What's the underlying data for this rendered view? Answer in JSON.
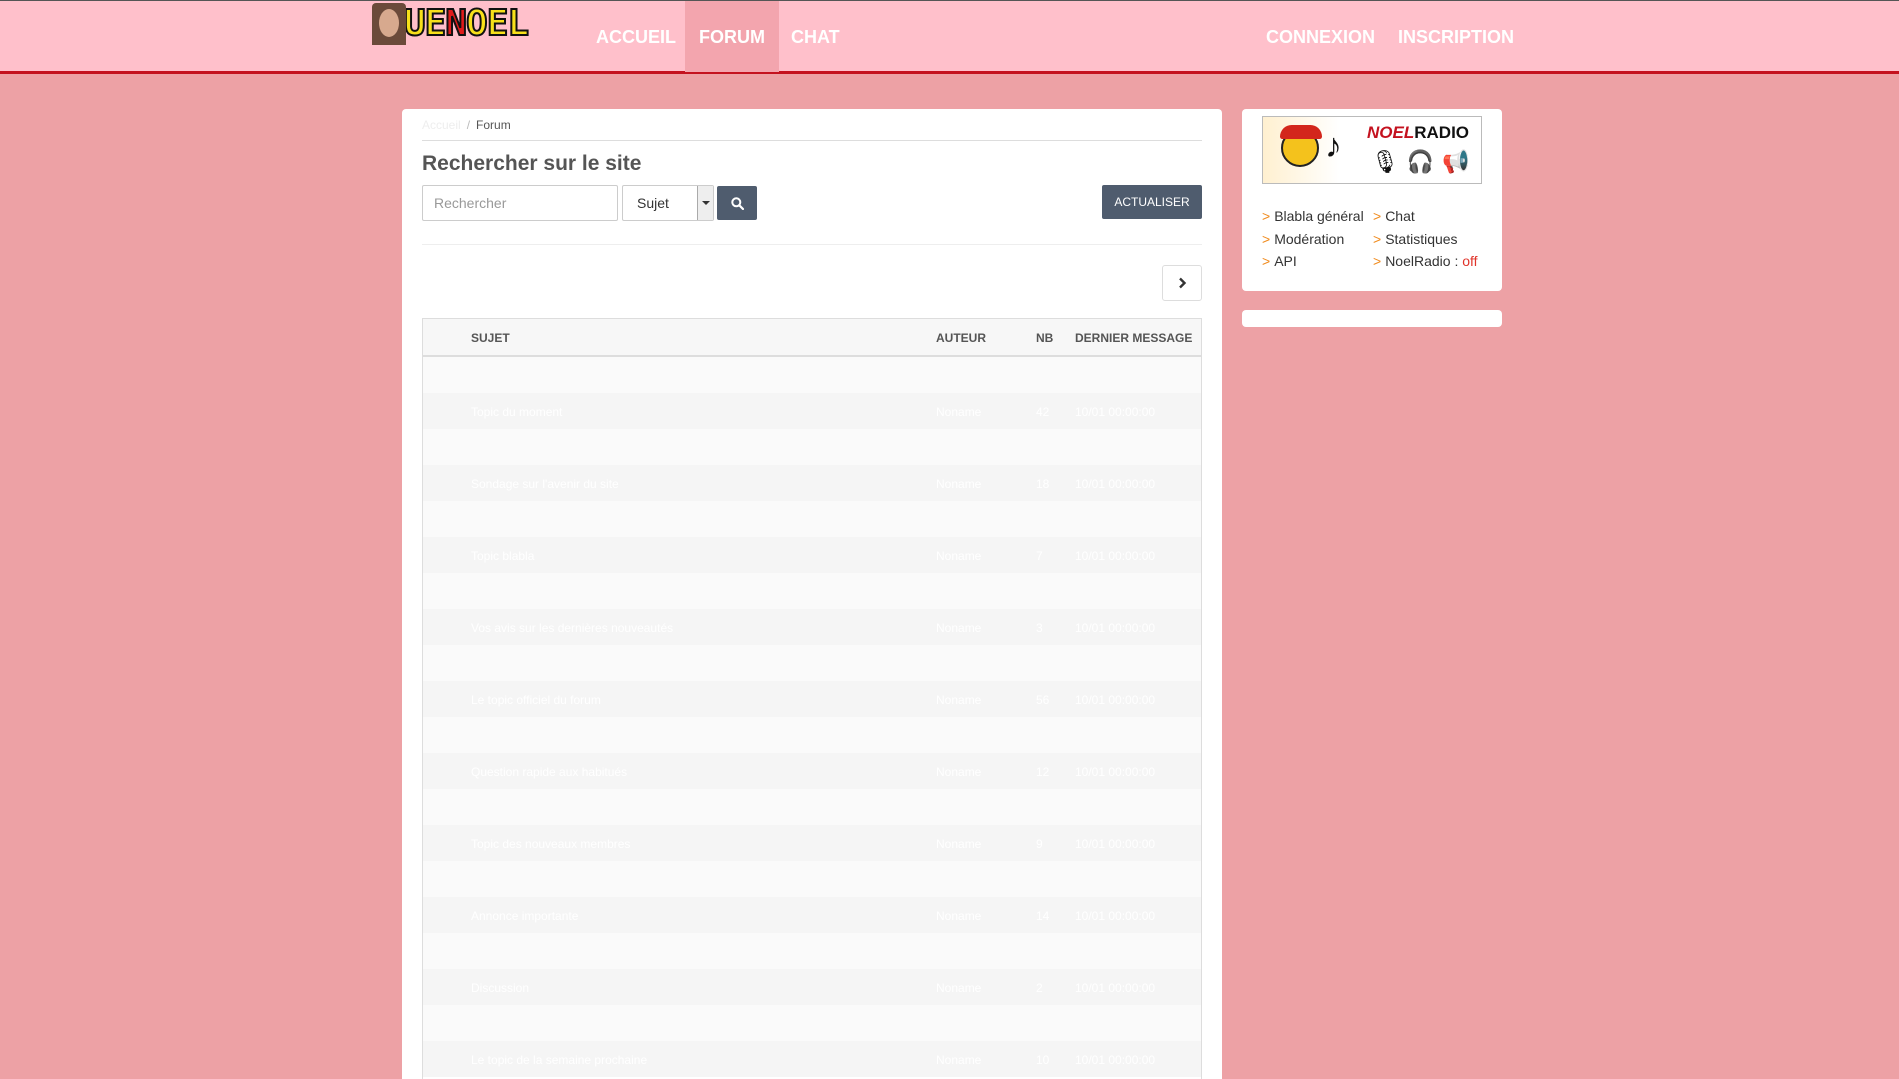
{
  "brand": {
    "logo_text_a": "UE",
    "logo_text_b": "N",
    "logo_text_c": "OEL"
  },
  "nav": {
    "left": [
      {
        "label": "ACCUEIL"
      },
      {
        "label": "FORUM"
      },
      {
        "label": "CHAT"
      }
    ],
    "right": [
      {
        "label": "CONNEXION"
      },
      {
        "label": "INSCRIPTION"
      }
    ]
  },
  "breadcrumb": {
    "home": "Accueil",
    "separator": "/",
    "current": "Forum"
  },
  "search": {
    "title": "Rechercher sur le site",
    "placeholder": "Rechercher",
    "scope": "Sujet",
    "button_icon": "search-icon",
    "refresh_label": "ACTUALISER"
  },
  "pagination": {
    "next_icon": "chevron-right-icon"
  },
  "table": {
    "headers": {
      "subject": "SUJET",
      "author": "AUTEUR",
      "count": "NB",
      "last": "DERNIER MESSAGE"
    },
    "rows": [
      {
        "subject": "",
        "author": "",
        "count": "",
        "last": ""
      },
      {
        "subject": "Topic du moment",
        "author": "Noname",
        "count": "42",
        "last": "10/01 00:00:00"
      },
      {
        "subject": "",
        "author": "",
        "count": "",
        "last": ""
      },
      {
        "subject": "Sondage sur l'avenir du site",
        "author": "Noname",
        "count": "18",
        "last": "10/01 00:00:00"
      },
      {
        "subject": "",
        "author": "",
        "count": "",
        "last": ""
      },
      {
        "subject": "Topic blabla",
        "author": "Noname",
        "count": "7",
        "last": "10/01 00:00:00"
      },
      {
        "subject": "",
        "author": "",
        "count": "",
        "last": ""
      },
      {
        "subject": "Vos avis sur les dernières nouveautés",
        "author": "Noname",
        "count": "3",
        "last": "10/01 00:00:00"
      },
      {
        "subject": "",
        "author": "",
        "count": "",
        "last": ""
      },
      {
        "subject": "Le topic officiel du forum",
        "author": "Noname",
        "count": "56",
        "last": "10/01 00:00:00"
      },
      {
        "subject": "",
        "author": "",
        "count": "",
        "last": ""
      },
      {
        "subject": "Question rapide aux habitués",
        "author": "Noname",
        "count": "12",
        "last": "10/01 00:00:00"
      },
      {
        "subject": "",
        "author": "",
        "count": "",
        "last": ""
      },
      {
        "subject": "Topic des nouveaux membres",
        "author": "Noname",
        "count": "9",
        "last": "10/01 00:00:00"
      },
      {
        "subject": "",
        "author": "",
        "count": "",
        "last": ""
      },
      {
        "subject": "Annonce importante",
        "author": "Noname",
        "count": "14",
        "last": "10/01 00:00:00"
      },
      {
        "subject": "",
        "author": "",
        "count": "",
        "last": ""
      },
      {
        "subject": "Discussion",
        "author": "Noname",
        "count": "2",
        "last": "10/01 00:00:00"
      },
      {
        "subject": "",
        "author": "",
        "count": "",
        "last": ""
      },
      {
        "subject": "Le topic de la semaine prochaine",
        "author": "Noname",
        "count": "10",
        "last": "10/01 00:00:00"
      }
    ]
  },
  "sidebar": {
    "radio": {
      "title_a": "NOEL",
      "title_b": "RADIO",
      "icons": "🎙🎧📢"
    },
    "links": [
      {
        "prefix": ">",
        "label": "Blabla général"
      },
      {
        "prefix": ">",
        "label": "Chat"
      },
      {
        "prefix": ">",
        "label": "Modération"
      },
      {
        "prefix": ">",
        "label": "Statistiques"
      },
      {
        "prefix": ">",
        "label": "API"
      },
      {
        "prefix": ">",
        "label": "NoelRadio : ",
        "status": "off"
      }
    ]
  },
  "colors": {
    "background": "#eda1a5",
    "nav": "#ffc0cb",
    "accent": "#c4121f",
    "button": "#4f5c6e"
  }
}
